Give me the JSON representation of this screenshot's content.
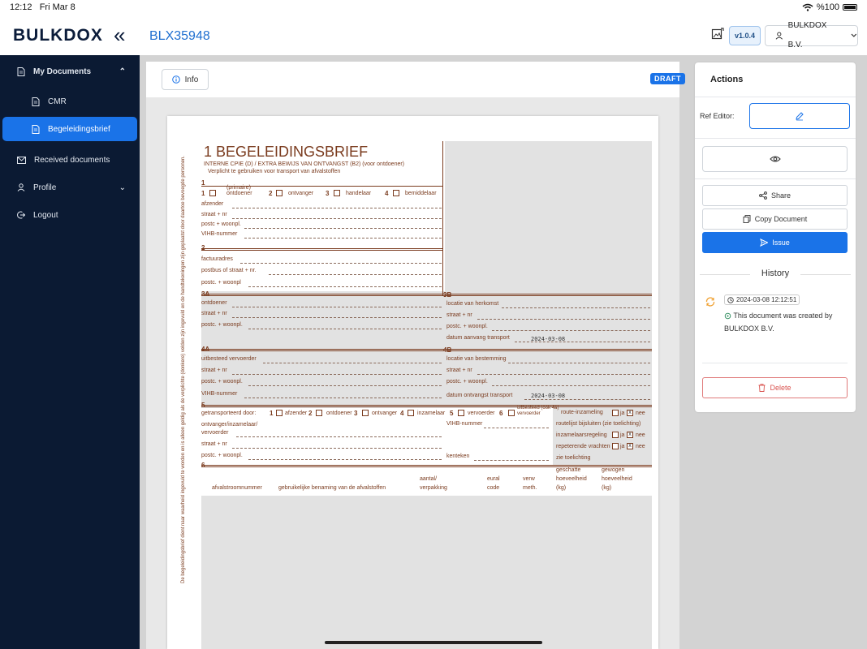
{
  "status_bar": {
    "time": "12:12",
    "date": "Fri Mar 8",
    "battery": "%100"
  },
  "header": {
    "logo": "BULKDOX",
    "collapse_icon": "double-chevron-left-icon",
    "document_id": "BLX35948",
    "version": "v1.0.4",
    "company": "BULKDOX B.V."
  },
  "sidebar": {
    "items": [
      {
        "label": "My Documents",
        "icon": "document-icon"
      },
      {
        "label": "CMR",
        "icon": "document-icon"
      },
      {
        "label": "Begeleidingsbrief",
        "icon": "document-icon"
      },
      {
        "label": "Received documents",
        "icon": "mail-icon"
      },
      {
        "label": "Profile",
        "icon": "user-icon"
      },
      {
        "label": "Logout",
        "icon": "logout-icon"
      }
    ]
  },
  "viewer": {
    "info_label": "Info",
    "draft_badge": "DRAFT"
  },
  "form": {
    "title": "1 BEGELEIDINGSBRIEF",
    "subtitle": "INTERNE CPIE (D) / EXTRA BEWIJS VAN ONTVANGST (B2)",
    "subtitle_suffix": "(voor ontdoener)",
    "subtitle2": "Verplicht te gebruiken voor transport van afvalstoffen",
    "side_note": "De begeleidingsbrief dient naar waarheid ingevuld te worden en is alleen geldig als de verplichte (donkere) velden zijn ingevuld en de handtekeningen zijn geplaatst door daartoe bevoegde personen.",
    "sec1": {
      "num": "1",
      "primaire": "(primaire)",
      "roles": [
        "ontdoener",
        "ontvanger",
        "handelaar",
        "bemiddelaar"
      ],
      "role_nums": [
        "1",
        "2",
        "3",
        "4"
      ],
      "fields": [
        "afzender",
        "straat + nr",
        "postc + woonpl.",
        "VIHB-nummer"
      ]
    },
    "sec2": {
      "num": "2",
      "fields": [
        "factuuradres",
        "postbus of straat + nr.",
        "postc. + woonpl"
      ]
    },
    "sec3a": {
      "num": "3A",
      "fields": [
        "ontdoener",
        "straat + nr",
        "postc. + woonpl."
      ]
    },
    "sec3b": {
      "num": "3B",
      "fields": [
        "locatie van herkomst",
        "straat + nr",
        "postc. + woonpl.",
        "datum aanvang transport"
      ],
      "date": "2024-03-08"
    },
    "sec4a": {
      "num": "4A",
      "fields": [
        "uitbesteed vervoerder",
        "straat + nr",
        "postc. + woonpl.",
        "VIHB-nummer"
      ]
    },
    "sec4b": {
      "num": "4B",
      "fields": [
        "locatie van bestemming",
        "straat + nr",
        "postc. + woonpl.",
        "datum ontvangst transport"
      ],
      "date": "2024-03-08"
    },
    "sec5": {
      "num": "5",
      "label": "getransporteerd door:",
      "roles": [
        "afzender",
        "ontdoener",
        "ontvanger",
        "inzamelaar",
        "vervoerder"
      ],
      "role_nums": [
        "1",
        "2",
        "3",
        "4",
        "5",
        "6"
      ],
      "uitbesteed": "uitbesteed",
      "uitbesteed_sub": "(ook 4a)",
      "uitbesteed_vervoerder": "vervoerder",
      "fields": [
        "ontvanger/inzamelaar/",
        "vervoerder",
        "straat + nr",
        "postc. + woonpl."
      ],
      "vihb": "VIHB-nummer",
      "kenteken": "kenteken",
      "right_options": [
        "route-inzameling",
        "routelijst bijsluiten (zie toelichting)",
        "inzamelaarsregeling",
        "repeterende vrachten",
        "zie toelichting"
      ],
      "ja": "ja",
      "nee": "nee"
    },
    "sec6": {
      "num": "6",
      "columns": [
        "afvalstroomnummer",
        "gebruikelijke benaming van de afvalstoffen",
        "aantal/",
        "verpakking",
        "eural",
        "code",
        "verw",
        "meth.",
        "geschatte",
        "hoeveelheid",
        "(kg)",
        "gewogen",
        "hoeveelheid",
        "(kg)"
      ]
    }
  },
  "actions": {
    "title": "Actions",
    "ref_editor_label": "Ref Editor:",
    "share": "Share",
    "copy": "Copy Document",
    "issue": "Issue",
    "history_title": "History",
    "history": [
      {
        "timestamp": "2024-03-08 12:12:51",
        "text": "This document was created by BULKDOX B.V."
      }
    ],
    "delete": "Delete"
  },
  "colors": {
    "accent": "#1a73e8",
    "sidebar": "#0b1a33",
    "form_brown": "#7a3b1e",
    "danger": "#d9534f"
  }
}
